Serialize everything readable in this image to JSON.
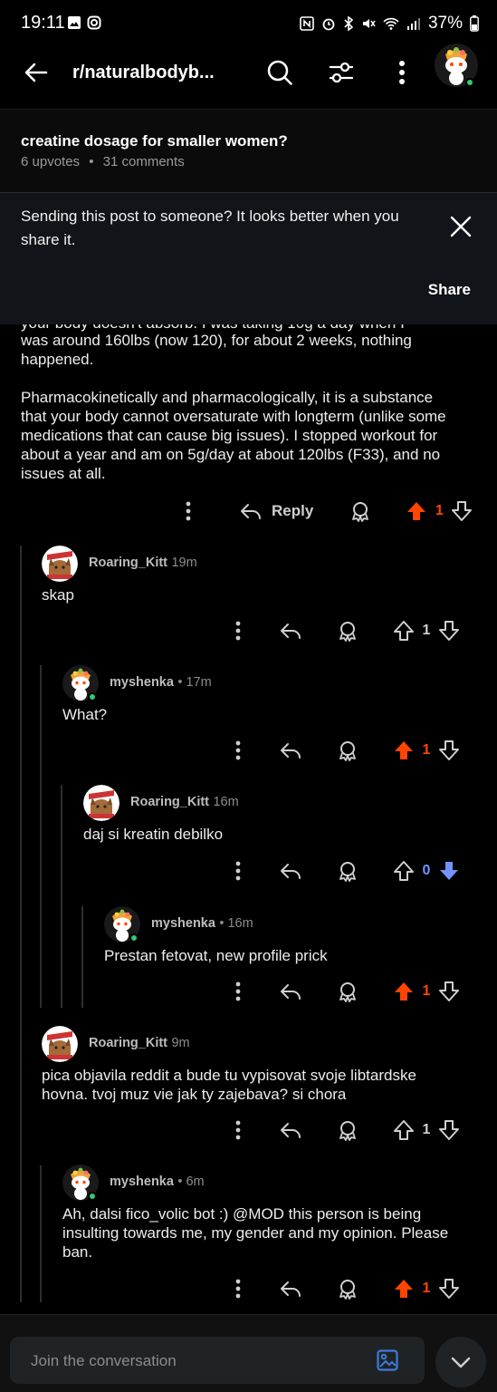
{
  "status_bar": {
    "time": "19:11",
    "battery": "37%"
  },
  "header": {
    "subreddit": "r/naturalbodyb..."
  },
  "post": {
    "title": "creatine dosage for smaller women?",
    "upvotes": "6 upvotes",
    "comments": "31 comments",
    "separator": "•"
  },
  "banner": {
    "text": "Sending this post to someone? It looks better when you share it.",
    "share_label": "Share"
  },
  "top_comment": {
    "partial_line": "your body doesn't absorb. I was taking 10g a day when I",
    "lines": [
      "was around 160lbs (now 120), for about 2 weeks, nothing",
      "happened.",
      "",
      "Pharmacokinetically and pharmacologically, it is a substance",
      "that your body cannot oversaturate with longterm (unlike some",
      "medications that can cause big issues). I stopped workout for",
      "about a year and am on 5g/day at about 120lbs (F33), and no",
      "issues at all."
    ],
    "reply_label": "Reply",
    "votes": "1"
  },
  "replies": [
    {
      "user": "Roaring_Kitt",
      "time": "19m",
      "body": [
        "skap"
      ],
      "votes": "1",
      "vote_state": "none"
    },
    {
      "user": "myshenka",
      "time": "• 17m",
      "body": [
        "What?"
      ],
      "votes": "1",
      "vote_state": "up"
    },
    {
      "user": "Roaring_Kitt",
      "time": "16m",
      "body": [
        "daj si kreatin debilko"
      ],
      "votes": "0",
      "vote_state": "down"
    },
    {
      "user": "myshenka",
      "time": "• 16m",
      "body": [
        "Prestan fetovat, new profile prick"
      ],
      "votes": "1",
      "vote_state": "up"
    },
    {
      "user": "Roaring_Kitt",
      "time": "9m",
      "body": [
        "pica objavila reddit a bude tu vypisovat svoje libtardske",
        "hovna. tvoj muz vie jak ty zajebava? si chora"
      ],
      "votes": "1",
      "vote_state": "none"
    },
    {
      "user": "myshenka",
      "time": "• 6m",
      "body": [
        "Ah, dalsi fico_volic bot :) @MOD this person is being",
        "insulting towards me, my gender and my opinion. Please",
        "ban."
      ],
      "votes": "1",
      "vote_state": "up"
    }
  ],
  "composer": {
    "placeholder": "Join the conversation"
  },
  "colors": {
    "upvote": "#ff4500",
    "downvote": "#7193ff",
    "online": "#2ecc71"
  }
}
